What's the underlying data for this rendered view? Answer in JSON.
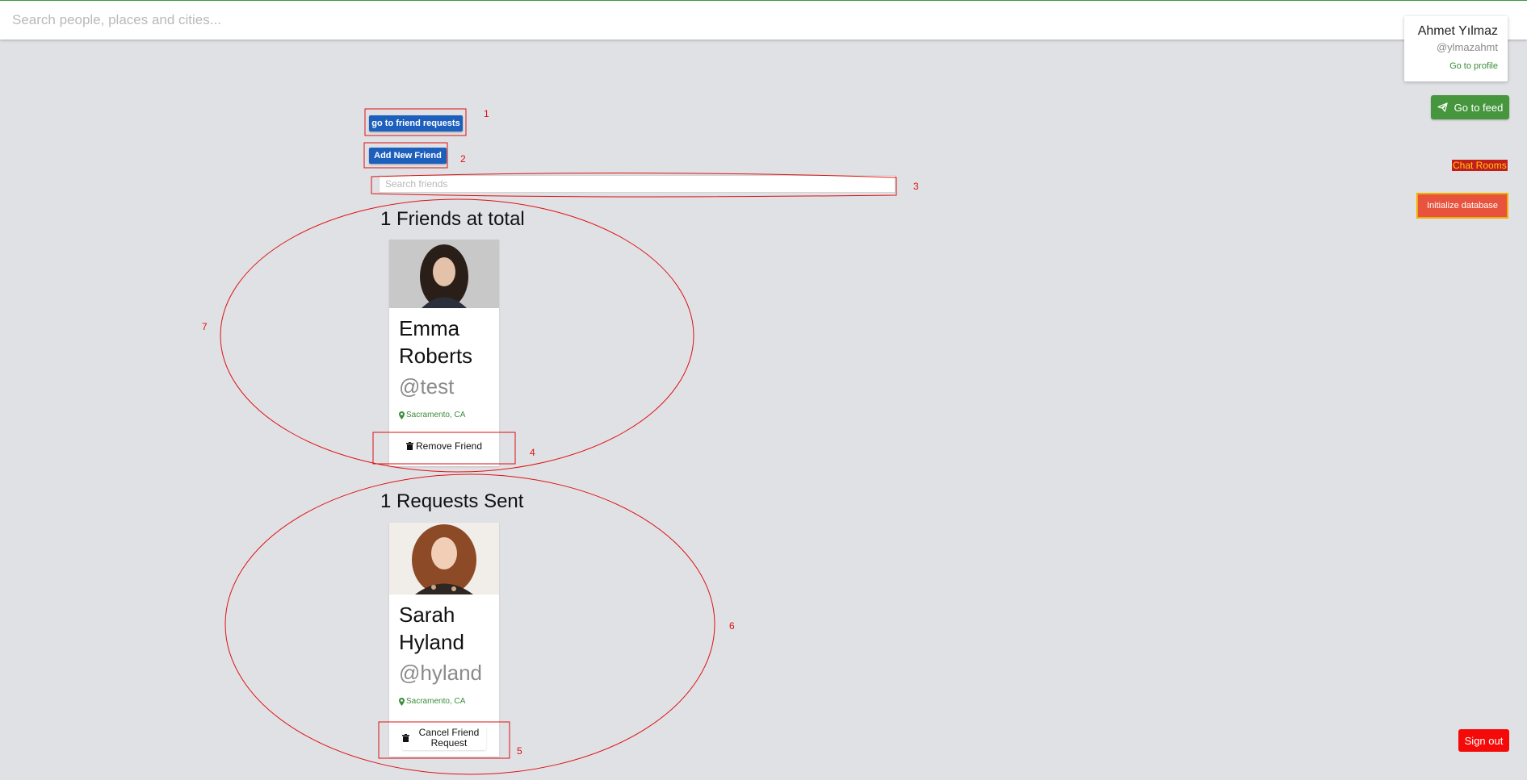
{
  "topbar": {
    "search_placeholder": "Search people, places and cities..."
  },
  "profile": {
    "name": "Ahmet Yılmaz",
    "handle": "@ylmazahmt",
    "link": "Go to profile"
  },
  "sidebar": {
    "feed_label": "Go to feed",
    "chat_rooms_label": "Chat Rooms",
    "init_db_label": "Initialize database",
    "signout_label": "Sign out"
  },
  "toolbar": {
    "friend_requests_label": "go to friend requests",
    "add_friend_label": "Add New Friend",
    "friend_search_placeholder": "Search friends"
  },
  "friends": {
    "title": "1 Friends at total",
    "items": [
      {
        "first": "Emma",
        "last": "Roberts",
        "username": "@test",
        "location": "Sacramento, CA",
        "action": "Remove Friend"
      }
    ]
  },
  "sent_requests": {
    "title": "1 Requests Sent",
    "items": [
      {
        "first": "Sarah",
        "last": "Hyland",
        "username": "@hyland",
        "location": "Sacramento, CA",
        "action": "Cancel Friend Request"
      }
    ]
  },
  "annotations": [
    "1",
    "2",
    "3",
    "4",
    "5",
    "6",
    "7"
  ],
  "colors": {
    "accent_green": "#45963d",
    "button_blue": "#1d5fbc",
    "danger_red": "#f50a0a",
    "annotation_red": "#dd1111"
  }
}
